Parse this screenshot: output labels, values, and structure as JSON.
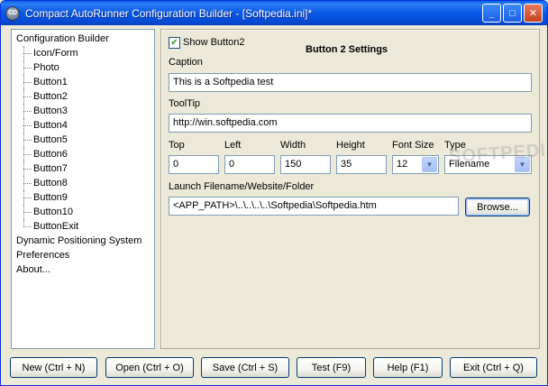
{
  "window": {
    "title": "Compact AutoRunner Configuration Builder - [Softpedia.ini]*",
    "app_icon_text": "CD"
  },
  "titlebar_buttons": {
    "minimize": "_",
    "maximize": "□",
    "close": "✕"
  },
  "tree": {
    "items": [
      {
        "label": "Configuration Builder",
        "child": false
      },
      {
        "label": "Icon/Form",
        "child": true
      },
      {
        "label": "Photo",
        "child": true
      },
      {
        "label": "Button1",
        "child": true
      },
      {
        "label": "Button2",
        "child": true
      },
      {
        "label": "Button3",
        "child": true
      },
      {
        "label": "Button4",
        "child": true
      },
      {
        "label": "Button5",
        "child": true
      },
      {
        "label": "Button6",
        "child": true
      },
      {
        "label": "Button7",
        "child": true
      },
      {
        "label": "Button8",
        "child": true
      },
      {
        "label": "Button9",
        "child": true
      },
      {
        "label": "Button10",
        "child": true
      },
      {
        "label": "ButtonExit",
        "child": true
      },
      {
        "label": "Dynamic Positioning System",
        "child": false
      },
      {
        "label": "Preferences",
        "child": false
      },
      {
        "label": "About...",
        "child": false
      }
    ]
  },
  "settings": {
    "heading": "Button 2 Settings",
    "show_checkbox": {
      "label": "Show Button2",
      "checked": true,
      "mark": "✔"
    },
    "caption": {
      "label": "Caption",
      "value": "This is a Softpedia test"
    },
    "tooltip": {
      "label": "ToolTip",
      "value": "http://win.softpedia.com"
    },
    "top": {
      "label": "Top",
      "value": "0"
    },
    "left": {
      "label": "Left",
      "value": "0"
    },
    "width": {
      "label": "Width",
      "value": "150"
    },
    "height": {
      "label": "Height",
      "value": "35"
    },
    "font_size": {
      "label": "Font Size",
      "value": "12"
    },
    "type": {
      "label": "Type",
      "value": "Filename"
    },
    "launch": {
      "label": "Launch Filename/Website/Folder",
      "value": "<APP_PATH>\\..\\..\\..\\..\\Softpedia\\Softpedia.htm"
    },
    "browse_label": "Browse..."
  },
  "watermark": "SOFTPEDIA",
  "footer": {
    "new": "New (Ctrl + N)",
    "open": "Open (Ctrl + O)",
    "save": "Save (Ctrl + S)",
    "test": "Test (F9)",
    "help": "Help (F1)",
    "exit": "Exit (Ctrl + Q)"
  }
}
